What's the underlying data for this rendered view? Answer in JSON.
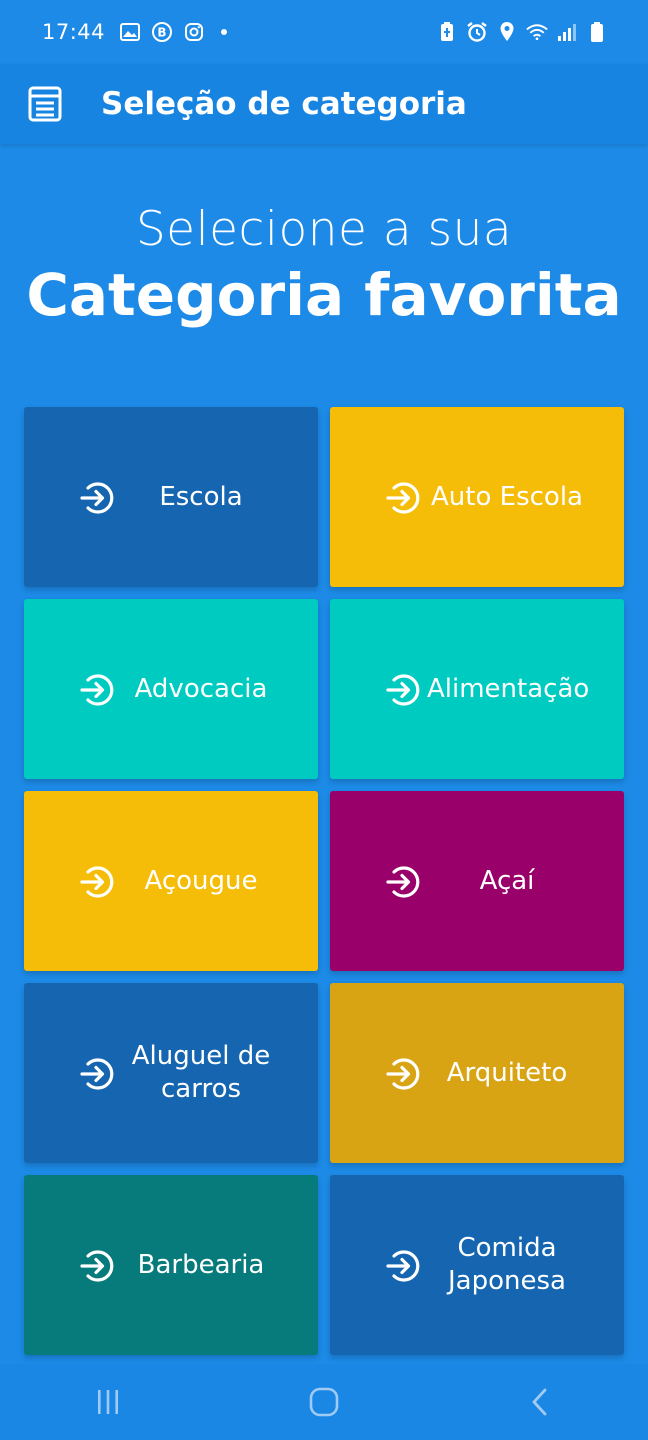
{
  "status_bar": {
    "time": "17:44",
    "left_icons": [
      "gallery-icon",
      "b-icon",
      "instagram-icon"
    ],
    "right_icons": [
      "battery-saver-icon",
      "alarm-icon",
      "location-icon",
      "wifi-icon",
      "signal-icon",
      "battery-icon"
    ]
  },
  "app_bar": {
    "title": "Seleção de categoria",
    "menu_icon": "list-icon"
  },
  "headline": {
    "line1": "Selecione a sua",
    "line2": "Categoria favorita"
  },
  "categories": [
    {
      "label": "Escola",
      "color": "#1565b0"
    },
    {
      "label": "Auto Escola",
      "color": "#f5bd08"
    },
    {
      "label": "Advocacia",
      "color": "#00cbc0"
    },
    {
      "label": "Alimentação",
      "color": "#00cbc0"
    },
    {
      "label": "Açougue",
      "color": "#f5bd08"
    },
    {
      "label": "Açaí",
      "color": "#9a006a"
    },
    {
      "label": "Aluguel de carros",
      "color": "#1565b0"
    },
    {
      "label": "Arquiteto",
      "color": "#d9a414"
    },
    {
      "label": "Barbearia",
      "color": "#077b7b"
    },
    {
      "label": "Comida Japonesa",
      "color": "#1565b0"
    }
  ],
  "nav_bar": {
    "buttons": [
      "recent-apps-icon",
      "home-icon",
      "back-icon"
    ]
  },
  "colors": {
    "background": "#1c8ae6",
    "app_bar": "#1784e2"
  }
}
